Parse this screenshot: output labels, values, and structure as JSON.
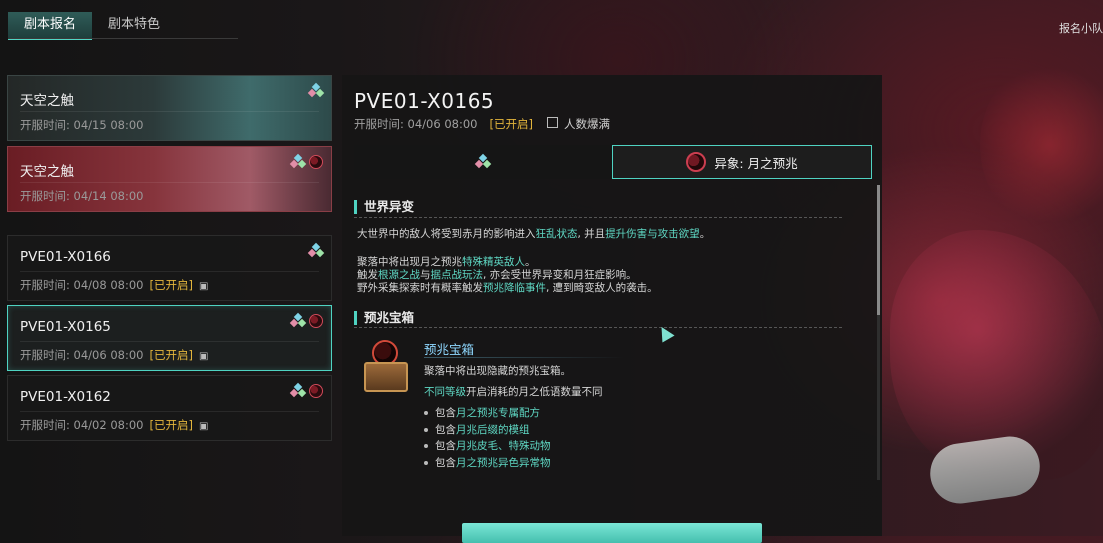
{
  "top_tabs": [
    {
      "label": "剧本报名",
      "active": true
    },
    {
      "label": "剧本特色",
      "active": false
    }
  ],
  "corner_label": "报名小队",
  "featured": [
    {
      "name": "天空之触",
      "time": "开服时间: 04/15 08:00"
    },
    {
      "name": "天空之触",
      "time": "开服时间: 04/14 08:00"
    }
  ],
  "servers": [
    {
      "name": "PVE01-X0166",
      "time": "开服时间: 04/08 08:00",
      "status": "[已开启]"
    },
    {
      "name": "PVE01-X0165",
      "time": "开服时间: 04/06 08:00",
      "status": "[已开启]",
      "selected": true
    },
    {
      "name": "PVE01-X0162",
      "time": "开服时间: 04/02 08:00",
      "status": "[已开启]"
    }
  ],
  "panel": {
    "title": "PVE01-X0165",
    "time": "开服时间: 04/06 08:00",
    "status": "[已开启]",
    "population": "人数爆满",
    "tab_anomaly": "异象: 月之预兆"
  },
  "world": {
    "heading": "世界异变",
    "l1a": "大世界中的敌人将受到赤月的影响进入",
    "l1b": "狂乱状态",
    "l1c": ", 并且",
    "l1d": "提升伤害与攻击欲望",
    "l1e": "。",
    "l2a": "聚落中将出现月之预兆",
    "l2b": "特殊精英敌人",
    "l2c": "。",
    "l3a": "触发",
    "l3b": "根源之战",
    "l3c": "与",
    "l3d": "据点战玩法",
    "l3e": ", 亦会受世界异变和月狂症影响。",
    "l4a": "野外采集探索时有概率触发",
    "l4b": "预兆降临事件",
    "l4c": ", 遭到畸变敌人的袭击。"
  },
  "chest": {
    "heading": "预兆宝箱",
    "title": "预兆宝箱",
    "desc": "聚落中将出现隐藏的预兆宝箱。",
    "cost_a": "不同等级",
    "cost_b": "开启消耗的月之低语数量不同",
    "b1a": "包含",
    "b1b": "月之预兆专属配方",
    "b2a": "包含",
    "b2b": "月兆后缀的模组",
    "b3a": "包含",
    "b3b": "月兆皮毛、特殊动物",
    "b4a": "包含",
    "b4b": "月之预兆异色异常物"
  },
  "colors": {
    "accent": "#4fd3c2",
    "open_status": "#e3b53c",
    "highlight": "#5fd8c4"
  },
  "icons": [
    "crystal-icon",
    "blood-moon-icon",
    "lock-icon",
    "person-icon",
    "chest-icon"
  ]
}
